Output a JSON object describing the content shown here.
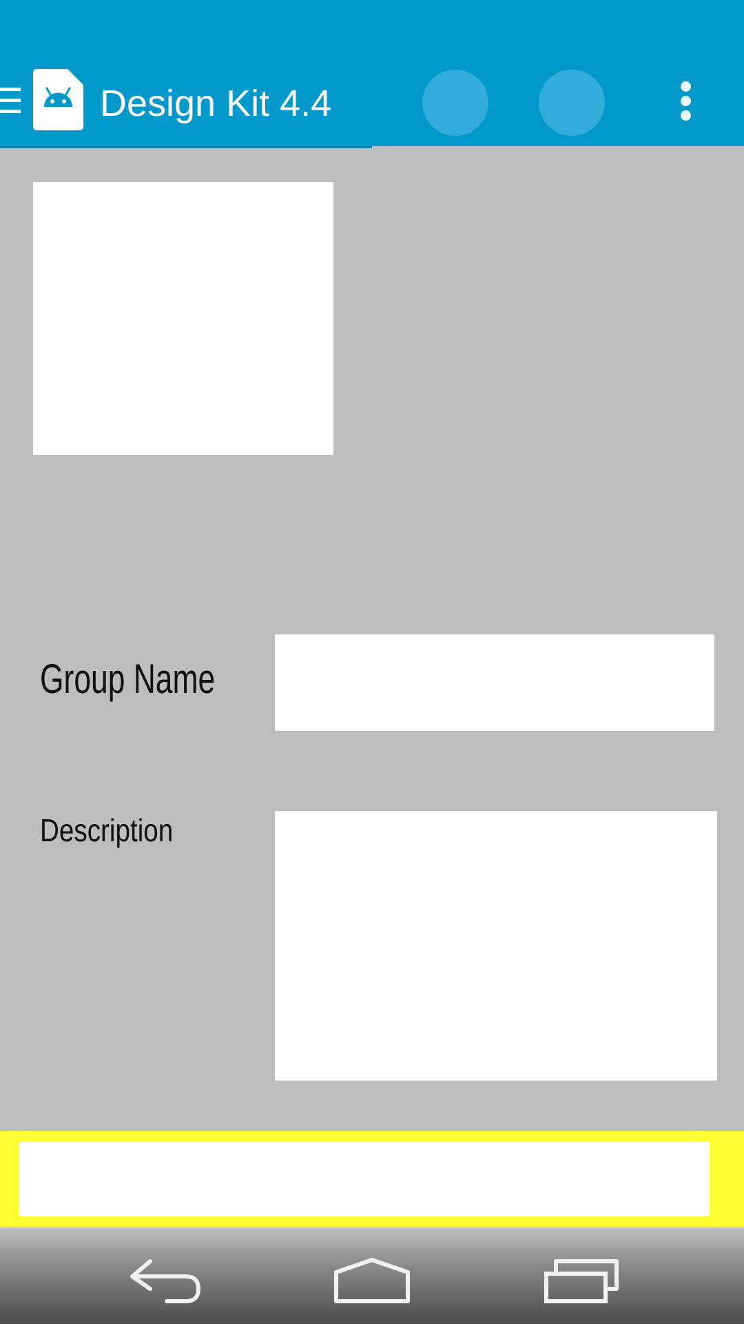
{
  "app_bar": {
    "title": "Design Kit 4.4",
    "color": "#0199cb",
    "icons": [
      "menu-icon",
      "android-app-icon",
      "action-icon",
      "action-icon",
      "overflow-icon"
    ]
  },
  "form": {
    "group_name_label": "Group Name",
    "group_name_value": "",
    "description_label": "Description",
    "description_value": "",
    "bottom_field_value": "",
    "bottom_strip_color": "#ffff33"
  },
  "nav_bar": {
    "icons": [
      "back-icon",
      "home-icon",
      "recent-apps-icon"
    ]
  }
}
